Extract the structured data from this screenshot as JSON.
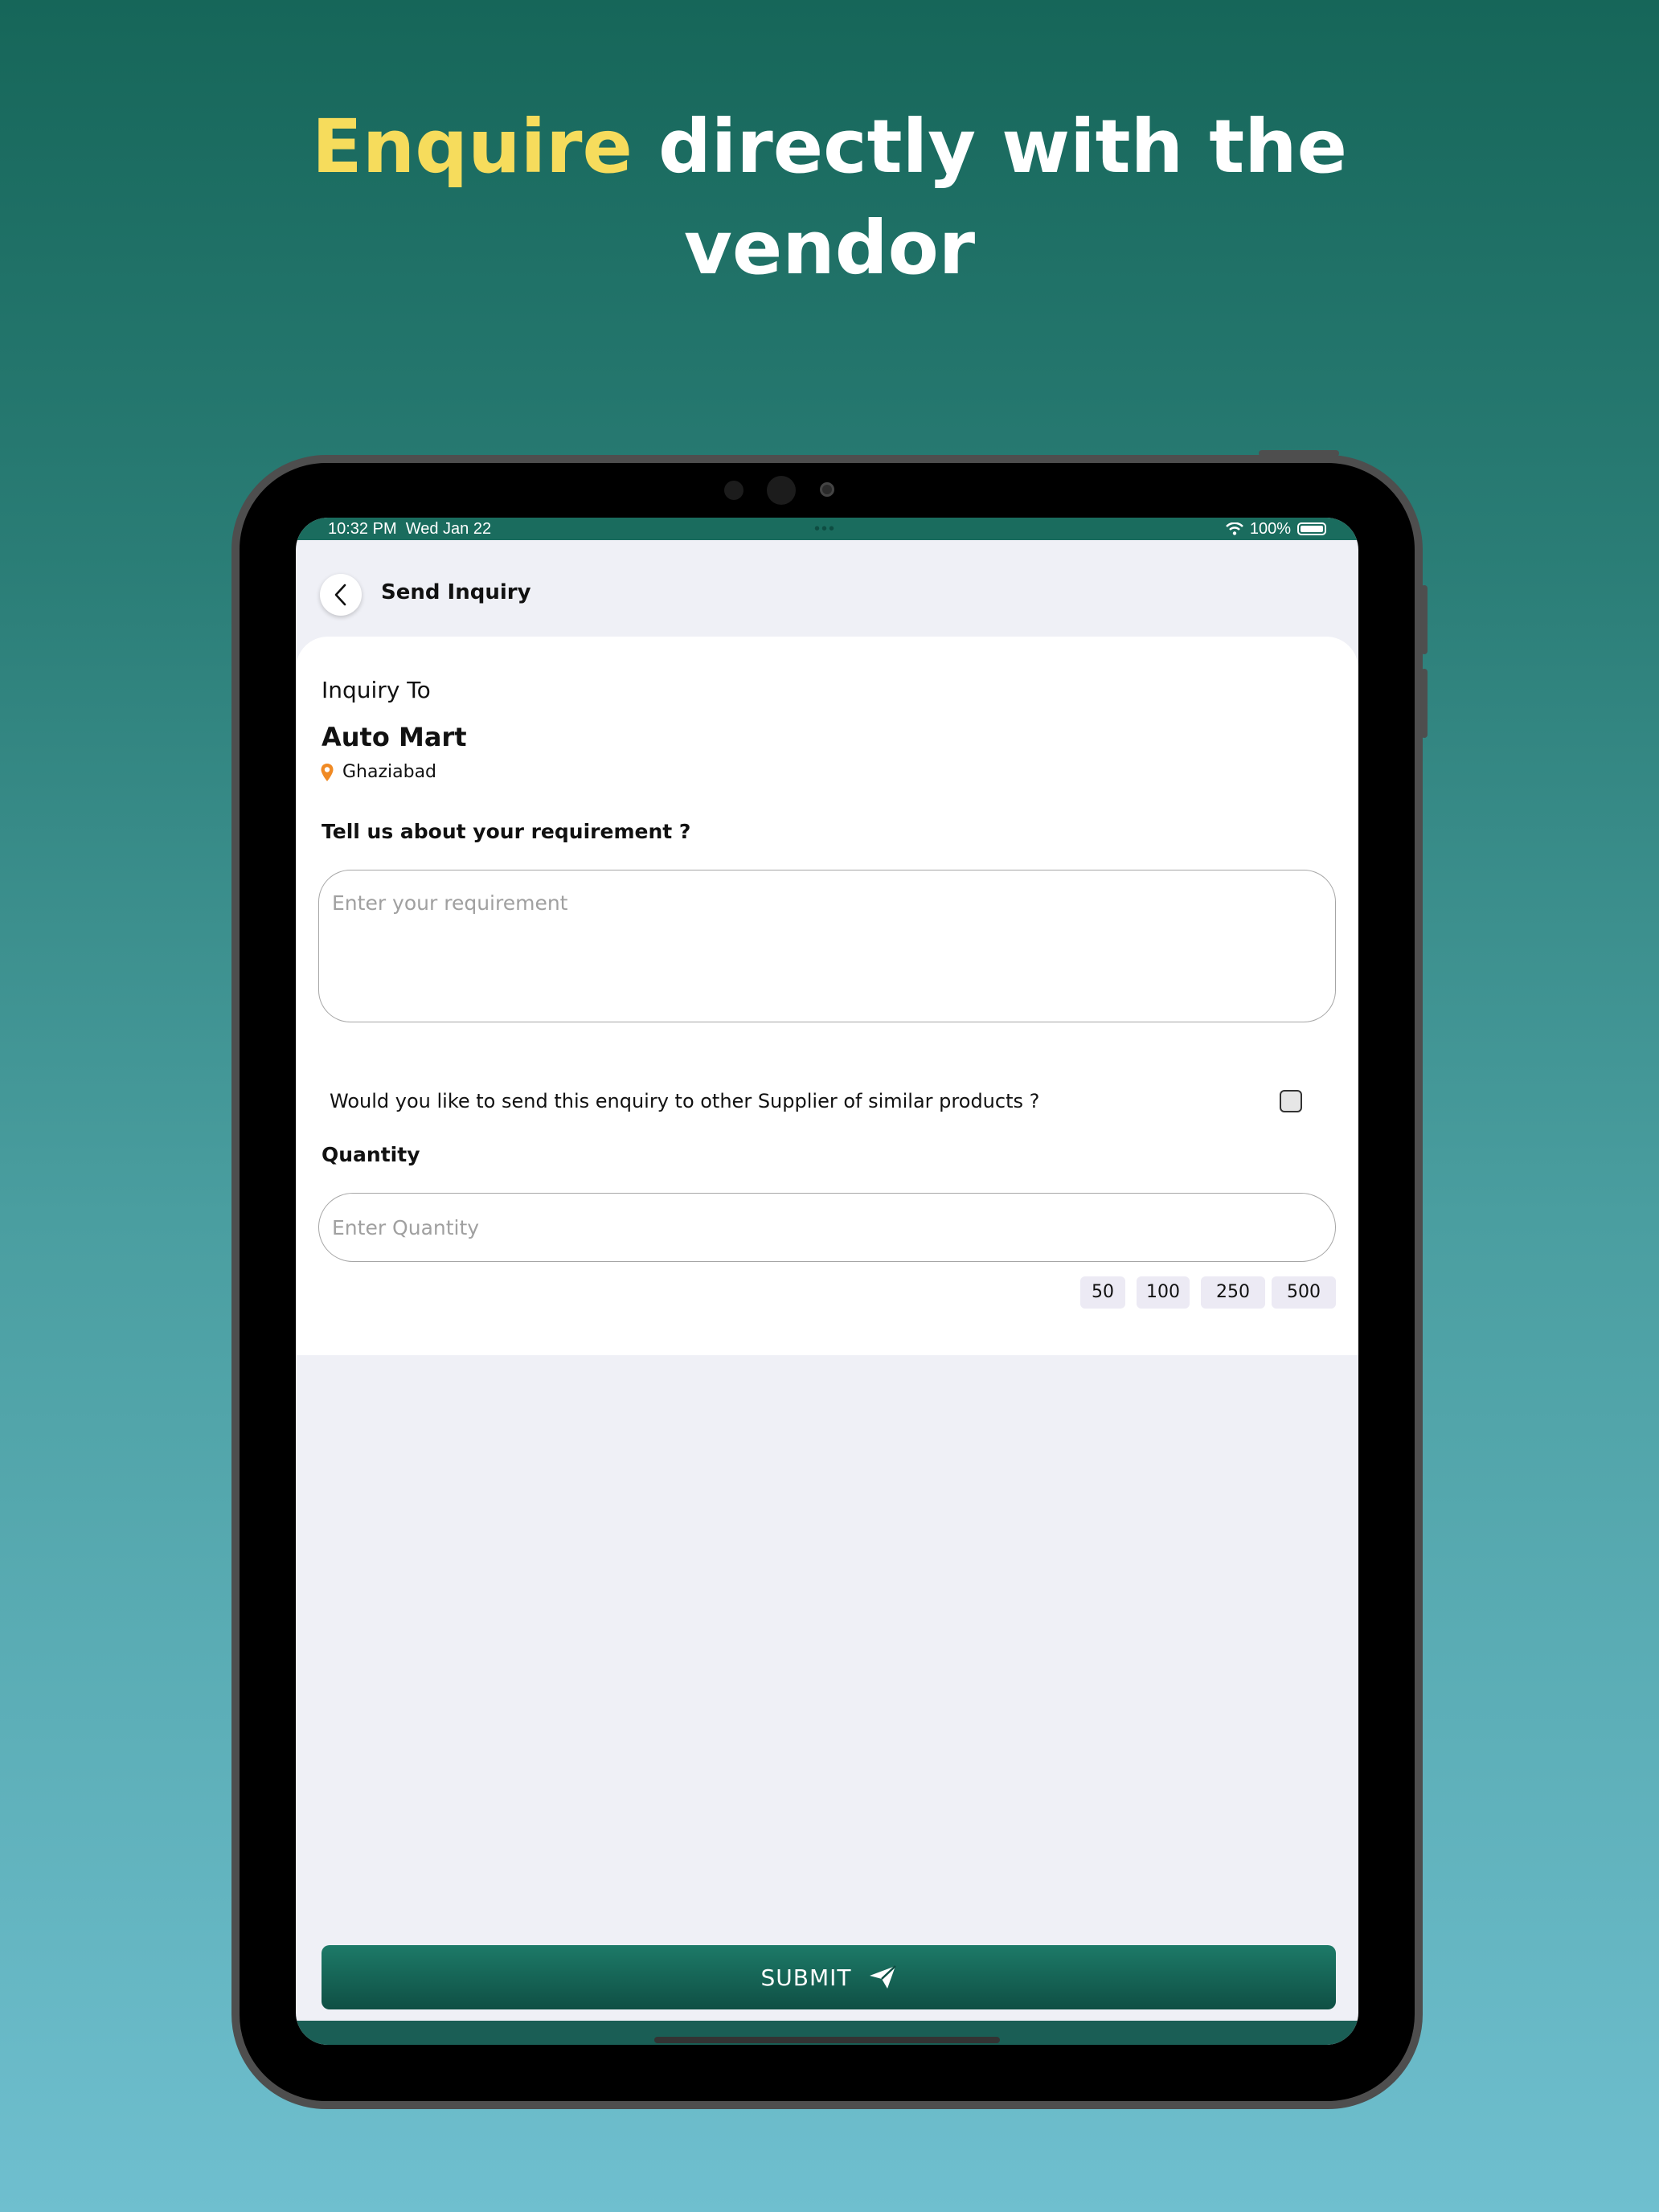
{
  "headline": {
    "highlight": "Enquire",
    "rest_line1": " directly with the",
    "rest_line2": "vendor"
  },
  "status_bar": {
    "time": "10:32 PM",
    "date": "Wed Jan 22",
    "battery": "100%",
    "dots": "•••"
  },
  "header": {
    "title": "Send Inquiry"
  },
  "inquiry": {
    "label": "Inquiry To",
    "vendor_name": "Auto Mart",
    "location": "Ghaziabad"
  },
  "requirement": {
    "label": "Tell us about your requirement ?",
    "placeholder": "Enter your requirement"
  },
  "similar_suppliers": {
    "text": "Would you like to send this enquiry to other Supplier of similar products ?",
    "checked": false
  },
  "quantity": {
    "label": "Quantity",
    "placeholder": "Enter Quantity",
    "chips": [
      "50",
      "100",
      "250",
      "500"
    ]
  },
  "submit": {
    "label": "SUBMIT"
  },
  "colors": {
    "accent_yellow": "#f6dc5c",
    "brand_green": "#1a6c5e",
    "pin_orange": "#f08a24"
  }
}
